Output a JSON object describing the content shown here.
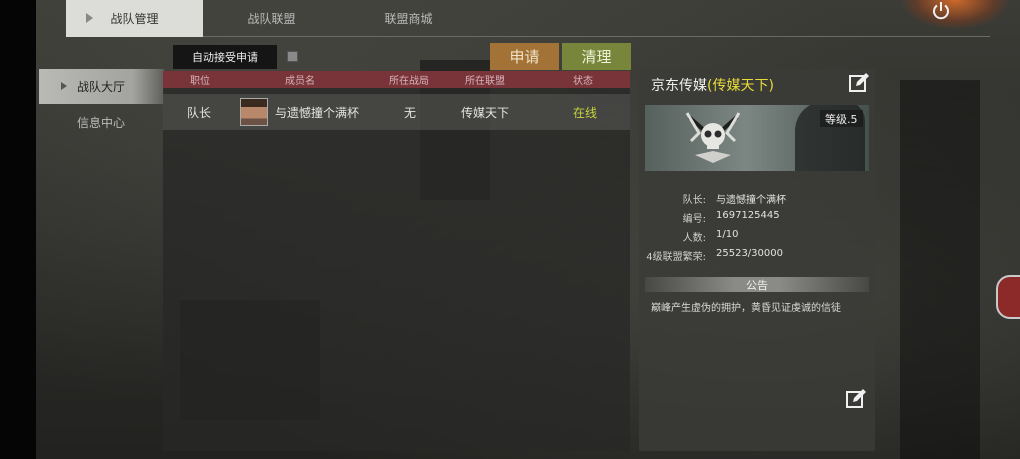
{
  "top_tabs": [
    "战队管理",
    "战队联盟",
    "联盟商城"
  ],
  "sidebar": {
    "items": [
      "战队大厅",
      "信息中心"
    ]
  },
  "actions": {
    "auto_accept": "自动接受申请",
    "apply": "申请",
    "clean": "清理"
  },
  "table": {
    "headers": [
      "职位",
      "成员名",
      "所在战局",
      "所在联盟",
      "状态"
    ],
    "rows": [
      {
        "position": "队长",
        "name": "与遗憾撞个满杯",
        "battle": "无",
        "league": "传媒天下",
        "status": "在线"
      }
    ]
  },
  "team": {
    "name": "京东传媒",
    "league": "(传媒天下)",
    "level": "等级.5",
    "info": [
      {
        "label": "队长:",
        "value": "与遗憾撞个满杯"
      },
      {
        "label": "编号:",
        "value": "1697125445"
      },
      {
        "label": "人数:",
        "value": "1/10"
      },
      {
        "label": "4级联盟繁荣:",
        "value": "25523/30000"
      }
    ],
    "notice_title": "公告",
    "notice_text": "巅峰产生虚伪的拥护，黄昏见证虔诚的信徒"
  },
  "colors": {
    "header_red": "#79343a",
    "apply": "#a27236",
    "clean": "#77863a",
    "online": "#c7d63a",
    "league": "#e8dc3a"
  },
  "icons": [
    "power-icon",
    "edit-icon",
    "skull-emblem-icon"
  ]
}
